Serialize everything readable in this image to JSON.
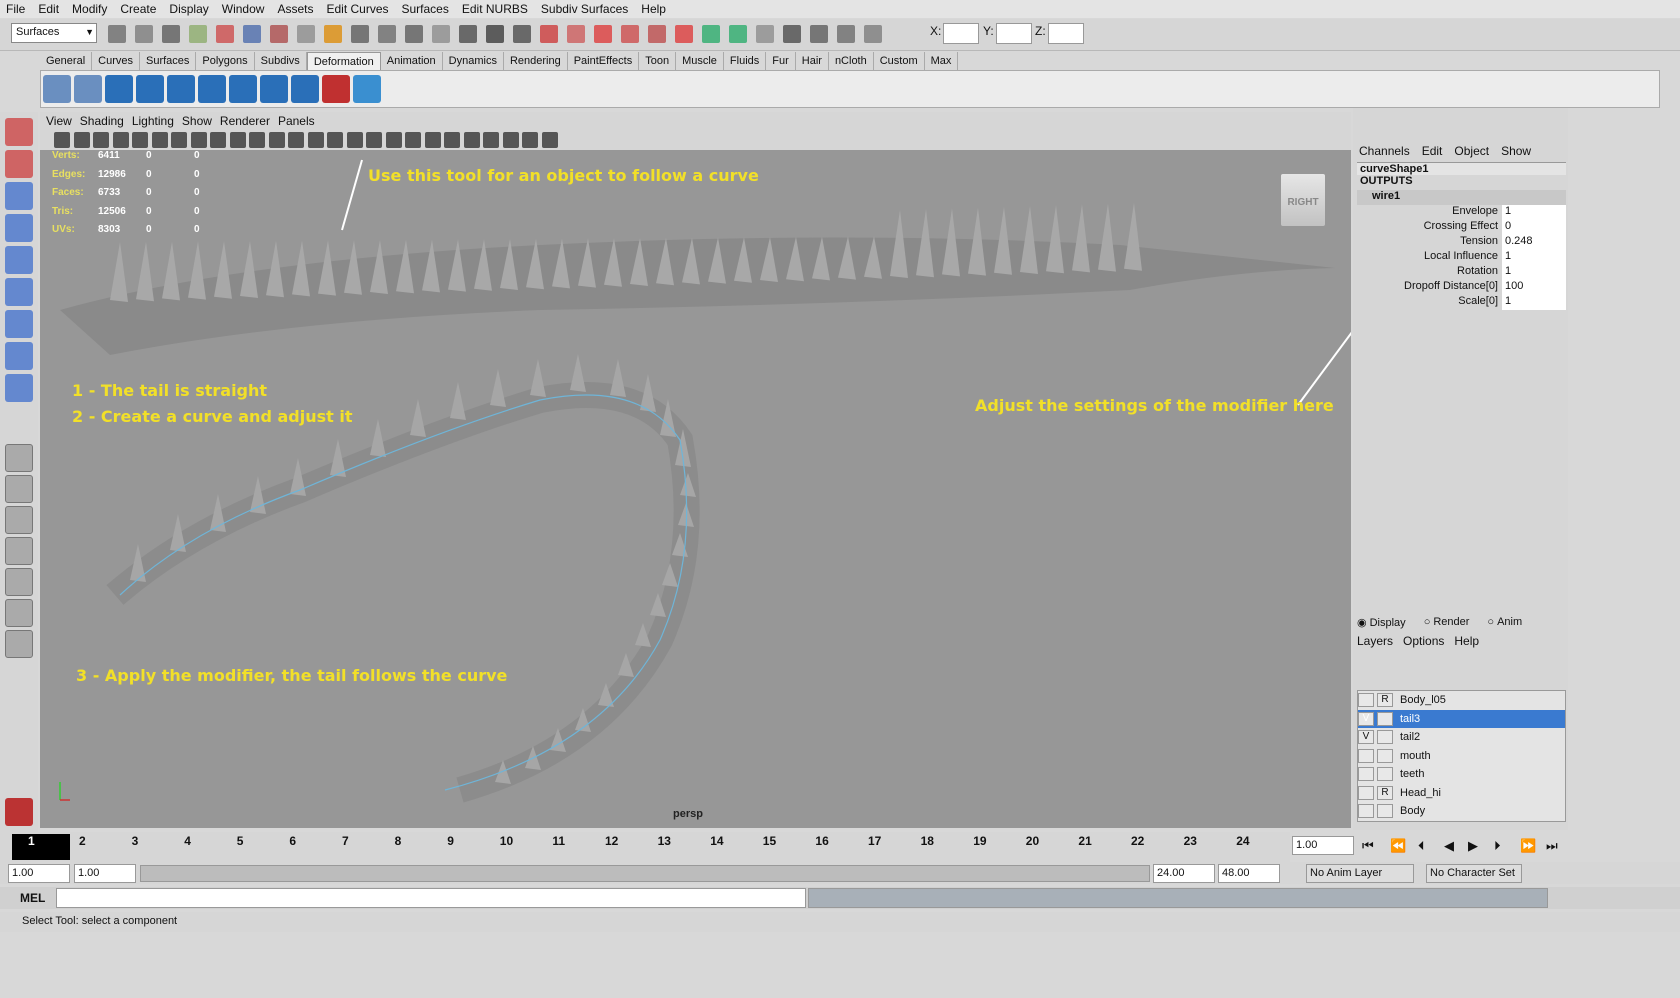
{
  "menu": [
    "File",
    "Edit",
    "Modify",
    "Create",
    "Display",
    "Window",
    "Assets",
    "Edit Curves",
    "Surfaces",
    "Edit NURBS",
    "Subdiv Surfaces",
    "Help"
  ],
  "status": {
    "menu_set": "Surfaces",
    "x_label": "X:",
    "y_label": "Y:",
    "z_label": "Z:"
  },
  "shelf_tabs": [
    "General",
    "Curves",
    "Surfaces",
    "Polygons",
    "Subdivs",
    "Deformation",
    "Animation",
    "Dynamics",
    "Rendering",
    "PaintEffects",
    "Toon",
    "Muscle",
    "Fluids",
    "Fur",
    "Hair",
    "nCloth",
    "Custom",
    "Max"
  ],
  "active_shelf_tab": "Deformation",
  "panel_menu": [
    "View",
    "Shading",
    "Lighting",
    "Show",
    "Renderer",
    "Panels"
  ],
  "hud": [
    {
      "label": "Verts:",
      "v": "6411",
      "a": "0",
      "b": "0"
    },
    {
      "label": "Edges:",
      "v": "12986",
      "a": "0",
      "b": "0"
    },
    {
      "label": "Faces:",
      "v": "6733",
      "a": "0",
      "b": "0"
    },
    {
      "label": "Tris:",
      "v": "12506",
      "a": "0",
      "b": "0"
    },
    {
      "label": "UVs:",
      "v": "8303",
      "a": "0",
      "b": "0"
    }
  ],
  "annotations": {
    "tool": "Use this tool for an object to follow a curve",
    "step1": "1 - The tail is straight",
    "step2": "2 - Create a curve and adjust it",
    "step3": "3 - Apply the modifier, the tail follows the curve",
    "settings": "Adjust the settings of the modifier here"
  },
  "viewcube_label": "RIGHT",
  "camera_label": "persp",
  "channel_box": {
    "menu": [
      "Channels",
      "Edit",
      "Object",
      "Show"
    ],
    "shape": "curveShape1",
    "outputs": "OUTPUTS",
    "node": "wire1",
    "attrs": [
      {
        "name": "Envelope",
        "value": "1"
      },
      {
        "name": "Crossing Effect",
        "value": "0"
      },
      {
        "name": "Tension",
        "value": "0.248"
      },
      {
        "name": "Local Influence",
        "value": "1"
      },
      {
        "name": "Rotation",
        "value": "1"
      },
      {
        "name": "Dropoff Distance[0]",
        "value": "100"
      },
      {
        "name": "Scale[0]",
        "value": "1"
      }
    ]
  },
  "layer_editor": {
    "modes": [
      "Display",
      "Render",
      "Anim"
    ],
    "menu": [
      "Layers",
      "Options",
      "Help"
    ],
    "layers": [
      {
        "name": "Body_l05",
        "v": "",
        "r": "R",
        "selected": false
      },
      {
        "name": "tail3",
        "v": "V",
        "r": "",
        "selected": true
      },
      {
        "name": "tail2",
        "v": "V",
        "r": "",
        "selected": false
      },
      {
        "name": "mouth",
        "v": "",
        "r": "",
        "selected": false
      },
      {
        "name": "teeth",
        "v": "",
        "r": "",
        "selected": false
      },
      {
        "name": "Head_hi",
        "v": "",
        "r": "R",
        "selected": false
      },
      {
        "name": "Body",
        "v": "",
        "r": "",
        "selected": false
      }
    ]
  },
  "timeline": {
    "current": "1",
    "ticks": [
      "2",
      "3",
      "4",
      "5",
      "6",
      "7",
      "8",
      "9",
      "10",
      "11",
      "12",
      "13",
      "14",
      "15",
      "16",
      "17",
      "18",
      "19",
      "20",
      "21",
      "22",
      "23",
      "24"
    ],
    "frame_field": "1.00"
  },
  "range": {
    "start": "1.00",
    "play_start": "1.00",
    "play_end": "24.00",
    "end": "48.00",
    "anim_layer": "No Anim Layer",
    "char_set": "No Character Set"
  },
  "mel_label": "MEL",
  "help_text": "Select Tool: select a component"
}
